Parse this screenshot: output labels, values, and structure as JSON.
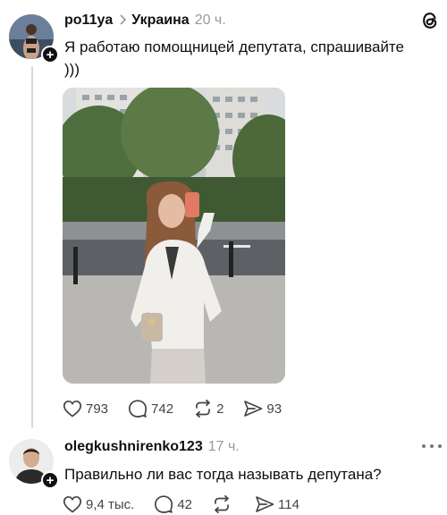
{
  "post": {
    "username": "po11ya",
    "topic": "Украина",
    "time": "20 ч.",
    "text": "Я работаю помощницей депутата, спрашивайте )))",
    "likes": "793",
    "replies": "742",
    "reposts": "2",
    "shares": "93"
  },
  "reply": {
    "username": "olegkushnirenko123",
    "time": "17 ч.",
    "text": "Правильно ли вас тогда называть депутана?",
    "likes": "9,4 тыс.",
    "replies": "42",
    "reposts": "",
    "shares": "114"
  },
  "icons": {
    "app_logo": "threads-logo-icon",
    "like": "heart-icon",
    "reply": "comment-icon",
    "repost": "repost-icon",
    "share": "send-icon",
    "follow": "plus-icon",
    "more": "more-icon"
  },
  "colors": {
    "text": "#101010",
    "secondary": "#999999",
    "thread_line": "#d9d9d9"
  }
}
